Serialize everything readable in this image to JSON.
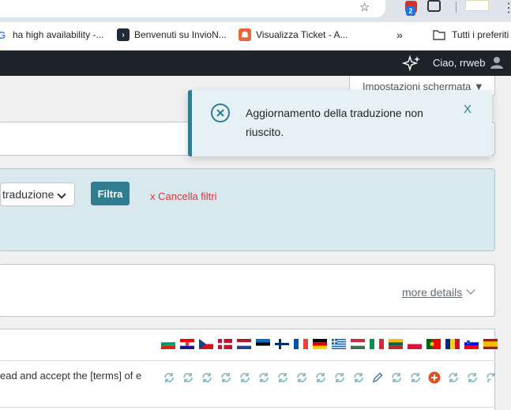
{
  "browser": {
    "extension_badge_count": "2",
    "bookmarks": [
      {
        "label": "ha high availability -...",
        "icon": "google-icon"
      },
      {
        "label": "Benvenuti su InvioN...",
        "icon": "invionet-icon"
      },
      {
        "label": "Visualizza Ticket - A...",
        "icon": "ticket-icon"
      }
    ],
    "overflow_label": "»",
    "folder_label": "Tutti i preferiti"
  },
  "adminbar": {
    "greeting": "Ciao, rrweb"
  },
  "screen_options": {
    "label": "Impostazioni schermata ▼"
  },
  "notice": {
    "message": "Aggiornamento della traduzione non riuscito.",
    "close_label": "X",
    "icon": "error-circle-icon"
  },
  "filters": {
    "select_value": "traduzione",
    "filter_button": "Filtra",
    "clear_label": "x  Cancella filtri"
  },
  "details": {
    "more_details_label": "more details"
  },
  "table": {
    "row_text": "ead and accept the [terms] of e",
    "languages": [
      "bg",
      "hr",
      "cs",
      "da",
      "nl",
      "et",
      "fi",
      "fr",
      "de",
      "el",
      "hu",
      "it",
      "lt",
      "pl",
      "pt",
      "ro",
      "sl",
      "es"
    ],
    "status_icons": [
      "sync",
      "sync",
      "sync",
      "sync",
      "sync",
      "sync",
      "sync",
      "sync",
      "sync",
      "sync",
      "sync",
      "edit",
      "sync",
      "sync",
      "add",
      "sync",
      "sync",
      "sync"
    ]
  },
  "colors": {
    "admin_bar": "#1d2327",
    "accent": "#2f7d8f",
    "danger": "#d63638",
    "add_status": "#e2501e"
  }
}
